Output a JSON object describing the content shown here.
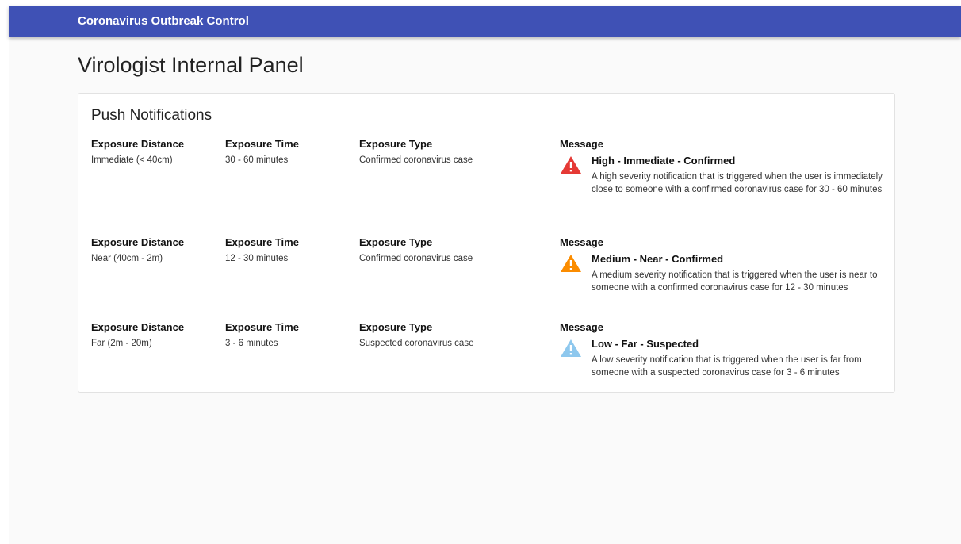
{
  "app": {
    "title": "Coronavirus Outbreak Control"
  },
  "page": {
    "title": "Virologist Internal Panel"
  },
  "card": {
    "title": "Push Notifications",
    "headers": {
      "distance": "Exposure Distance",
      "time": "Exposure Time",
      "type": "Exposure Type",
      "message": "Message"
    },
    "notifications": [
      {
        "distance": "Immediate (< 40cm)",
        "time": "30 - 60 minutes",
        "type": "Confirmed coronavirus case",
        "severity_icon": "warning-triangle-icon",
        "severity_color": "#e53935",
        "message_title": "High - Immediate - Confirmed",
        "message_text": "A high severity notification that is triggered when the user is immediately close to someone with a confirmed coronavirus case for 30 - 60 minutes"
      },
      {
        "distance": "Near (40cm - 2m)",
        "time": "12 - 30 minutes",
        "type": "Confirmed coronavirus case",
        "severity_icon": "warning-triangle-icon",
        "severity_color": "#fb8c00",
        "message_title": "Medium - Near - Confirmed",
        "message_text": "A medium severity notification that is triggered when the user is near to someone with a confirmed coronavirus case for 12 - 30 minutes"
      },
      {
        "distance": "Far (2m - 20m)",
        "time": "3 - 6 minutes",
        "type": "Suspected coronavirus case",
        "severity_icon": "warning-triangle-icon",
        "severity_color": "#8ec8ee",
        "message_title": "Low - Far - Suspected",
        "message_text": "A low severity notification that is triggered when the user is far from someone with a suspected coronavirus case for 3 - 6 minutes"
      }
    ]
  }
}
